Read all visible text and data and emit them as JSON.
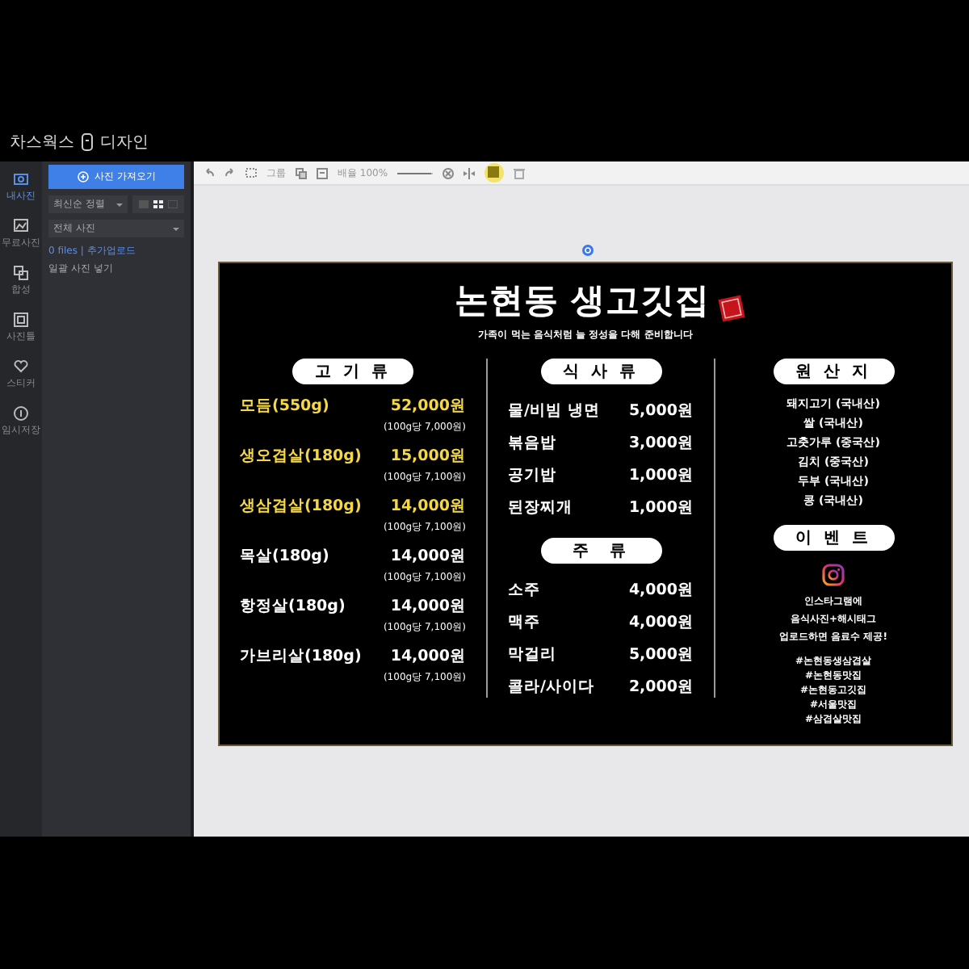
{
  "app": {
    "title_left": "차스웍스",
    "title_right": "디자인"
  },
  "rail": [
    {
      "label": "내사진",
      "selected": true
    },
    {
      "label": "무료사진",
      "selected": false
    },
    {
      "label": "합성",
      "selected": false
    },
    {
      "label": "사진틀",
      "selected": false
    },
    {
      "label": "스티커",
      "selected": false
    },
    {
      "label": "임시저장",
      "selected": false
    }
  ],
  "panel": {
    "upload_button": "사진 가져오기",
    "sort_dropdown": "최신순 정렬",
    "filter_dropdown": "전체 사진",
    "file_info": "0 files | 추가업로드",
    "bulk_link": "일괄 사진 넣기"
  },
  "toolbar": {
    "group_label": "그룹",
    "zoom_label": "배율 100%",
    "zoom": {
      "level": 0.95
    }
  },
  "design": {
    "title": "논현동 생고깃집",
    "subtitle": "가족이 먹는 음식처럼 늘 정성을 다해 준비합니다",
    "meat": {
      "heading": "고 기 류",
      "items": [
        {
          "name": "모듬(550g)",
          "price": "52,000원",
          "note": "(100g당 7,000원)",
          "highlight": true
        },
        {
          "name": "생오겹살(180g)",
          "price": "15,000원",
          "note": "(100g당 7,100원)",
          "highlight": true
        },
        {
          "name": "생삼겹살(180g)",
          "price": "14,000원",
          "note": "(100g당 7,100원)",
          "highlight": true
        },
        {
          "name": "목살(180g)",
          "price": "14,000원",
          "note": "(100g당 7,100원)",
          "highlight": false
        },
        {
          "name": "항정살(180g)",
          "price": "14,000원",
          "note": "(100g당 7,100원)",
          "highlight": false
        },
        {
          "name": "가브리살(180g)",
          "price": "14,000원",
          "note": "(100g당 7,100원)",
          "highlight": false
        }
      ]
    },
    "meals": {
      "heading": "식 사 류",
      "items": [
        {
          "name": "물/비빔 냉면",
          "price": "5,000원"
        },
        {
          "name": "볶음밥",
          "price": "3,000원"
        },
        {
          "name": "공기밥",
          "price": "1,000원"
        },
        {
          "name": "된장찌개",
          "price": "1,000원"
        }
      ]
    },
    "drinks": {
      "heading": "주  류",
      "items": [
        {
          "name": "소주",
          "price": "4,000원"
        },
        {
          "name": "맥주",
          "price": "4,000원"
        },
        {
          "name": "막걸리",
          "price": "5,000원"
        },
        {
          "name": "콜라/사이다",
          "price": "2,000원"
        }
      ]
    },
    "origin": {
      "heading": "원 산 지",
      "items": [
        "돼지고기 (국내산)",
        "쌀 (국내산)",
        "고춧가루 (중국산)",
        "김치 (중국산)",
        "두부 (국내산)",
        "콩 (국내산)"
      ]
    },
    "event": {
      "heading": "이 벤 트",
      "lines": [
        "인스타그램에",
        "음식사진+해시태그",
        "업로드하면 음료수 제공!"
      ],
      "hashtags": [
        "#논현동생삼겹살",
        "#논현동맛집",
        "#논현동고깃집",
        "#서울맛집",
        "#삼겹살맛집"
      ]
    }
  }
}
